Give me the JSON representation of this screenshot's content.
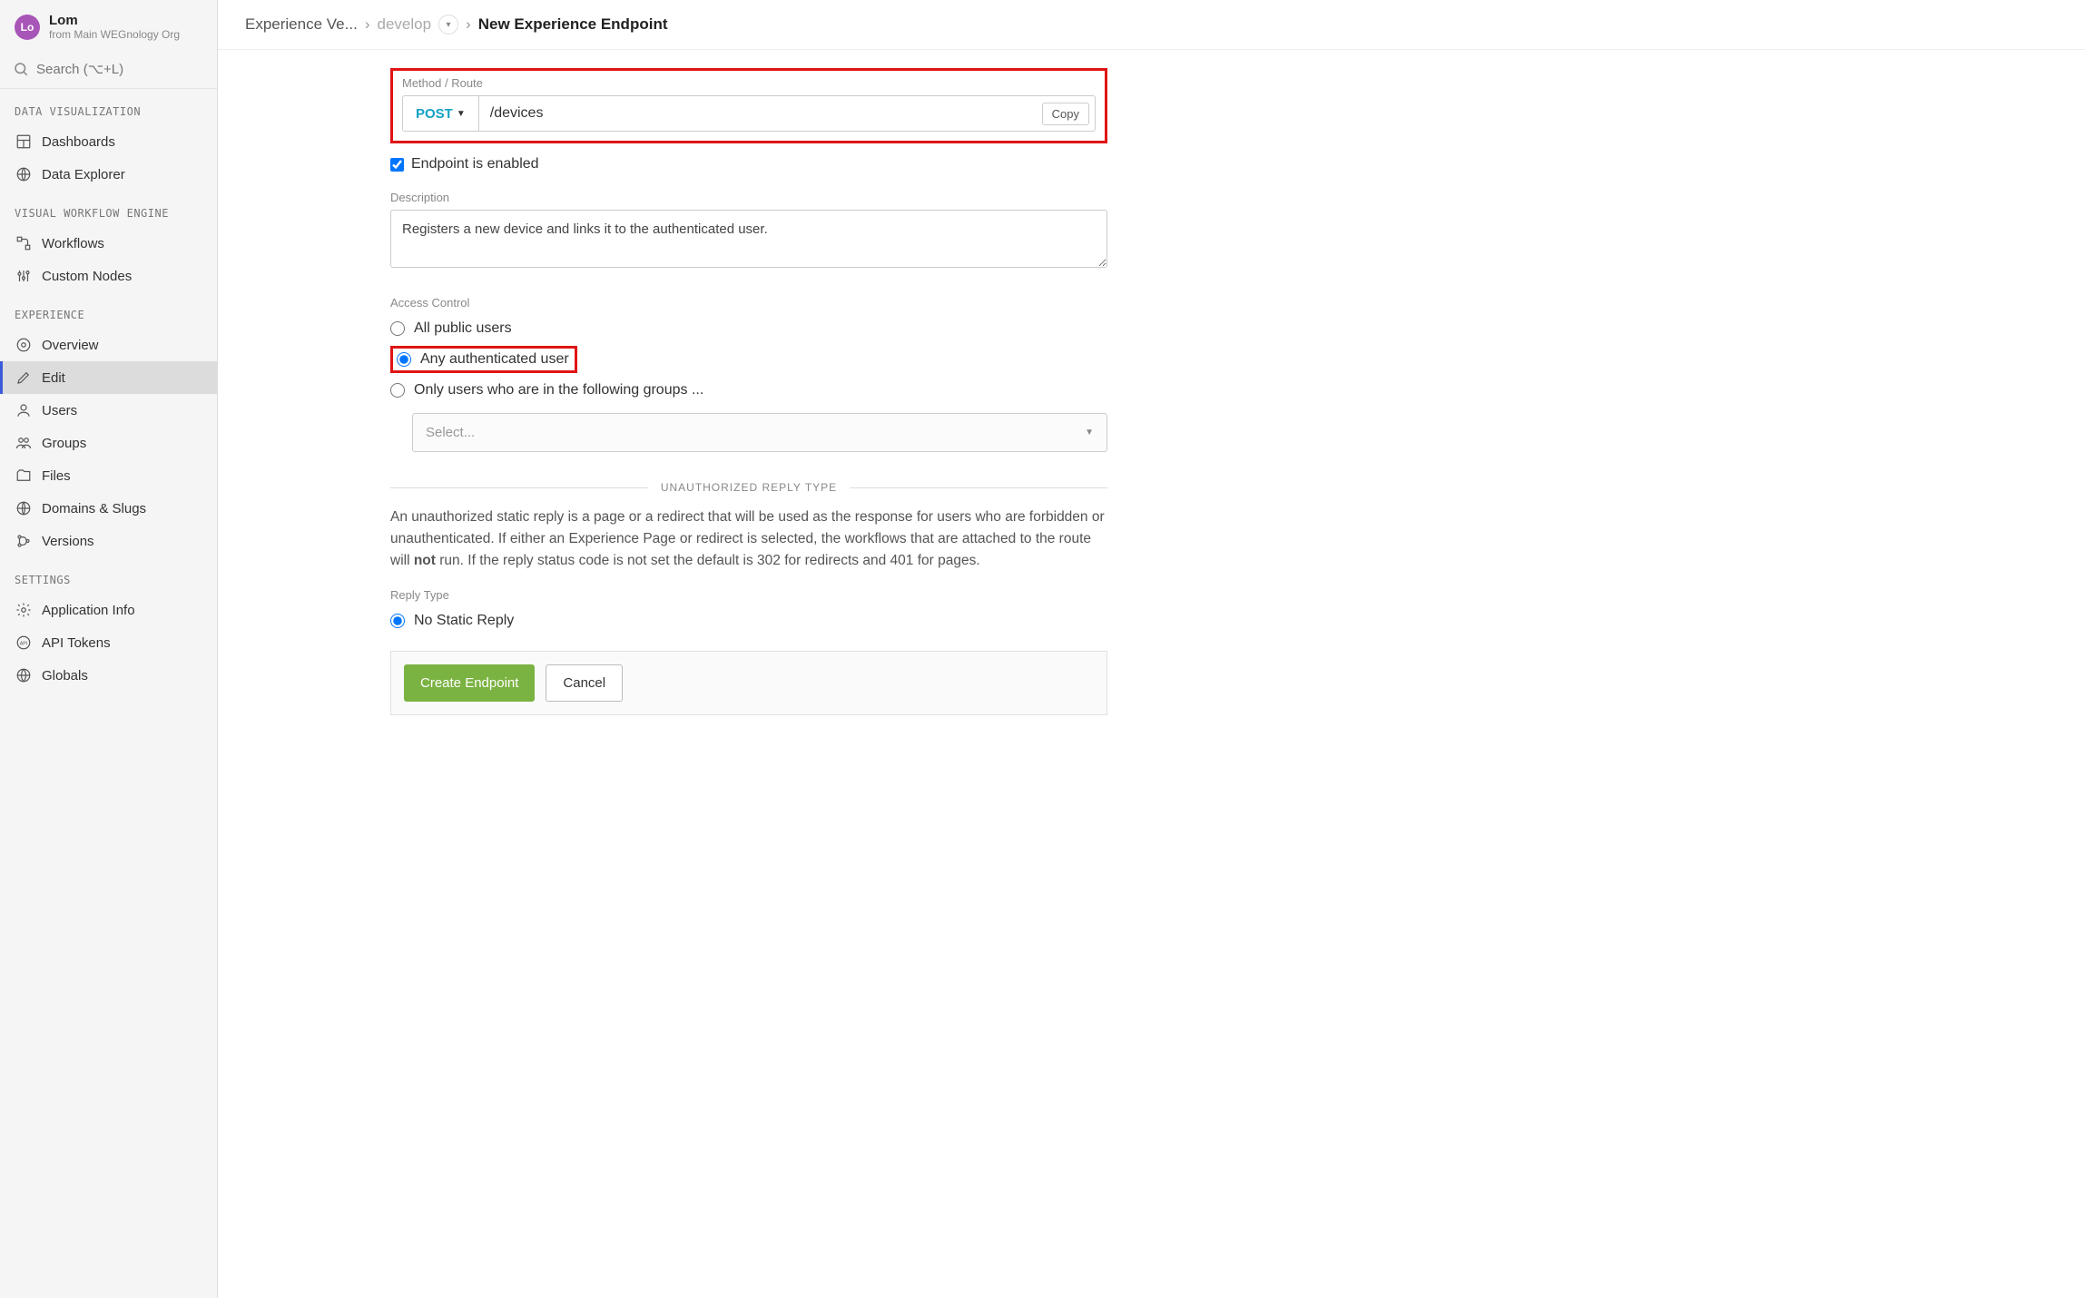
{
  "user": {
    "initials": "Lo",
    "name": "Lom",
    "sub": "from Main WEGnology Org"
  },
  "search": {
    "placeholder": "Search (⌥+L)"
  },
  "sections": {
    "data_viz": {
      "title": "DATA VISUALIZATION",
      "items": [
        "Dashboards",
        "Data Explorer"
      ]
    },
    "workflow": {
      "title": "VISUAL WORKFLOW ENGINE",
      "items": [
        "Workflows",
        "Custom Nodes"
      ]
    },
    "experience": {
      "title": "EXPERIENCE",
      "items": [
        "Overview",
        "Edit",
        "Users",
        "Groups",
        "Files",
        "Domains & Slugs",
        "Versions"
      ]
    },
    "settings": {
      "title": "SETTINGS",
      "items": [
        "Application Info",
        "API Tokens",
        "Globals"
      ]
    }
  },
  "breadcrumb": {
    "root": "Experience Ve...",
    "branch": "develop",
    "current": "New Experience Endpoint",
    "sep": "›"
  },
  "form": {
    "method_label": "Method / Route",
    "method": "POST",
    "route": "/devices",
    "copy": "Copy",
    "enabled_label": "Endpoint is enabled",
    "description_label": "Description",
    "description_value": "Registers a new device and links it to the authenticated user.",
    "access_label": "Access Control",
    "access_options": {
      "public": "All public users",
      "auth": "Any authenticated user",
      "groups": "Only users who are in the following groups ..."
    },
    "group_select_placeholder": "Select...",
    "unauth_title": "UNAUTHORIZED REPLY TYPE",
    "unauth_help_pre": "An unauthorized static reply is a page or a redirect that will be used as the response for users who are forbidden or unauthenticated. If either an Experience Page or redirect is selected, the workflows that are attached to the route will ",
    "unauth_help_bold": "not",
    "unauth_help_post": " run. If the reply status code is not set the default is 302 for redirects and 401 for pages.",
    "reply_type_label": "Reply Type",
    "reply_none": "No Static Reply",
    "create_btn": "Create Endpoint",
    "cancel_btn": "Cancel"
  }
}
